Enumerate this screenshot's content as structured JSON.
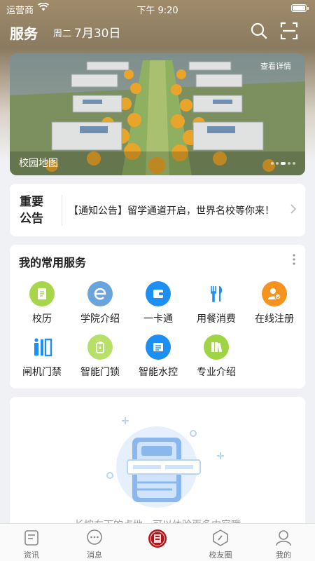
{
  "status_bar": {
    "carrier": "运营商",
    "time": "下午 9:20"
  },
  "header": {
    "title": "服务",
    "weekday": "周二",
    "date": "7月30日"
  },
  "banner": {
    "details": "查看详情",
    "caption": "校园地图"
  },
  "notice": {
    "label": "重要公告",
    "text": "【通知公告】留学通道开启，世界名校等你来！"
  },
  "services": {
    "title": "我的常用服务",
    "items": [
      {
        "label": "校历",
        "icon": "calendar-doc-icon",
        "color": "#a8d64a"
      },
      {
        "label": "学院介绍",
        "icon": "ie-browser-icon",
        "color": "#6aa4dc"
      },
      {
        "label": "一卡通",
        "icon": "wallet-icon",
        "color": "#1e8ff2"
      },
      {
        "label": "用餐消费",
        "icon": "fork-knife-icon",
        "color": "#ffffff"
      },
      {
        "label": "在线注册",
        "icon": "user-register-icon",
        "color": "#f5931e"
      },
      {
        "label": "闸机门禁",
        "icon": "gate-turnstile-icon",
        "color": "#ffffff"
      },
      {
        "label": "智能门锁",
        "icon": "lock-icon",
        "color": "#b7e06a"
      },
      {
        "label": "智能水控",
        "icon": "water-control-icon",
        "color": "#1e8ff2"
      },
      {
        "label": "专业介绍",
        "icon": "books-icon",
        "color": "#9fd444"
      }
    ]
  },
  "empty_state": {
    "hint": "长按右下的点地，可以体验更多内容哦"
  },
  "tabbar": {
    "tabs": [
      {
        "label": "资讯",
        "icon": "news-icon"
      },
      {
        "label": "消息",
        "icon": "message-icon"
      },
      {
        "label": "",
        "icon": "school-emblem-icon"
      },
      {
        "label": "校友圈",
        "icon": "compass-icon"
      },
      {
        "label": "我的",
        "icon": "profile-icon"
      }
    ]
  },
  "colors": {
    "accent": "#1e8ff2",
    "emblem": "#b3161c"
  }
}
